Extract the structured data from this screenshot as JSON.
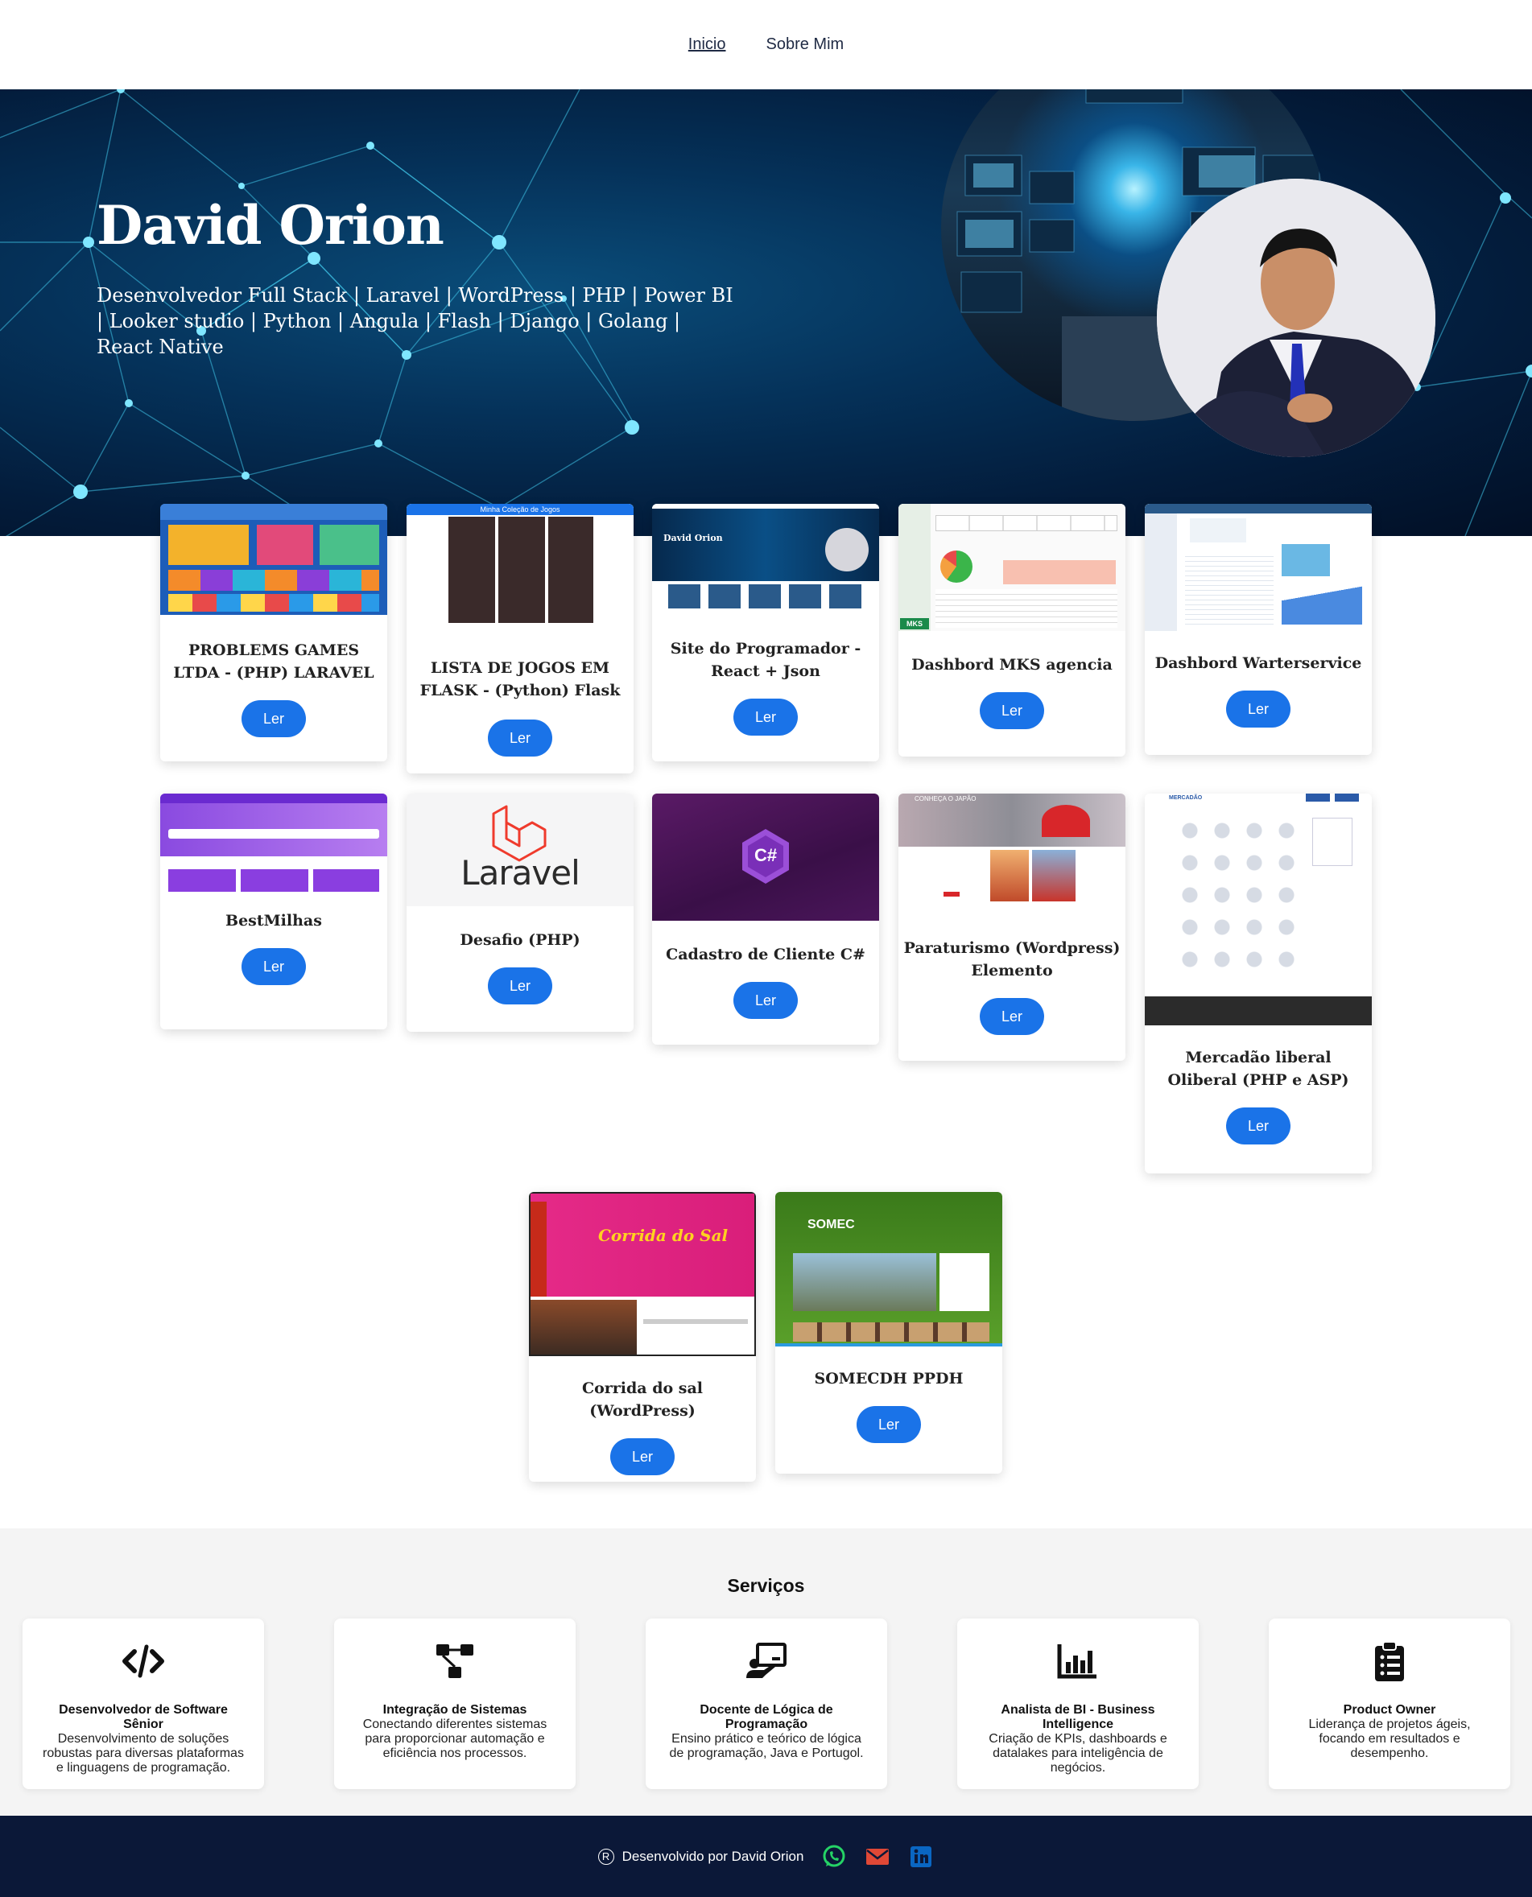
{
  "nav": {
    "items": [
      {
        "label": "Inicio",
        "active": true
      },
      {
        "label": "Sobre Mim",
        "active": false
      }
    ]
  },
  "hero": {
    "name": "David Orion",
    "subtitle": "Desenvolvedor Full Stack | Laravel | WordPress | PHP | Power BI | Looker studio | Python | Angula | Flash | Django | Golang | React Native"
  },
  "projects": {
    "button_label": "Ler",
    "items": [
      {
        "title": "PROBLEMS GAMES LTDA - (PHP) LARAVEL"
      },
      {
        "title": "LISTA DE JOGOS EM FLASK - (Python) Flask",
        "thumb_text": "Minha Coleção de Jogos"
      },
      {
        "title": "Site do Programador - React + Json",
        "thumb_text": "David Orion"
      },
      {
        "title": "Dashbord MKS agencia",
        "thumb_text": "MKS"
      },
      {
        "title": "Dashbord Warterservice"
      },
      {
        "title": "BestMilhas"
      },
      {
        "title": "Desafio (PHP)",
        "thumb_text": "Laravel"
      },
      {
        "title": "Cadastro de Cliente C#",
        "thumb_text": "C#"
      },
      {
        "title": "Paraturismo (Wordpress) Elemento",
        "thumb_text": "CONHEÇA O JAPÃO"
      },
      {
        "title": "Mercadão liberal Oliberal (PHP e ASP)",
        "thumb_text": "MERCADÃO"
      },
      {
        "title": "Corrida do sal (WordPress)",
        "thumb_text": "Corrida do Sal"
      },
      {
        "title": "SOMECDH PPDH",
        "thumb_text": "SOMEC"
      }
    ]
  },
  "services": {
    "heading": "Serviços",
    "items": [
      {
        "icon": "code-icon",
        "title": "Desenvolvedor de Software Sênior",
        "desc": "Desenvolvimento de soluções robustas para diversas plataformas e linguagens de programação."
      },
      {
        "icon": "sitemap-icon",
        "title": "Integração de Sistemas",
        "desc": "Conectando diferentes sistemas para proporcionar automação e eficiência nos processos."
      },
      {
        "icon": "teacher-icon",
        "title": "Docente de Lógica de Programação",
        "desc": "Ensino prático e teórico de lógica de programação, Java e Portugol."
      },
      {
        "icon": "bar-chart-icon",
        "title": "Analista de BI - Business Intelligence",
        "desc": "Criação de KPIs, dashboards e datalakes para inteligência de negócios."
      },
      {
        "icon": "clipboard-list-icon",
        "title": "Product Owner",
        "desc": "Liderança de projetos ágeis, focando em resultados e desempenho."
      }
    ]
  },
  "footer": {
    "registered_symbol": "R",
    "text": "Desenvolvido por David Orion",
    "icons": [
      "whatsapp-icon",
      "email-icon",
      "linkedin-icon"
    ],
    "colors": {
      "whatsapp": "#25d366",
      "email": "#e04836",
      "linkedin": "#0a66c2"
    }
  },
  "colors": {
    "accent": "#1a73e8",
    "hero_bg": "#031c3b",
    "footer_bg": "#0b1838",
    "services_bg": "#f4f4f4"
  }
}
